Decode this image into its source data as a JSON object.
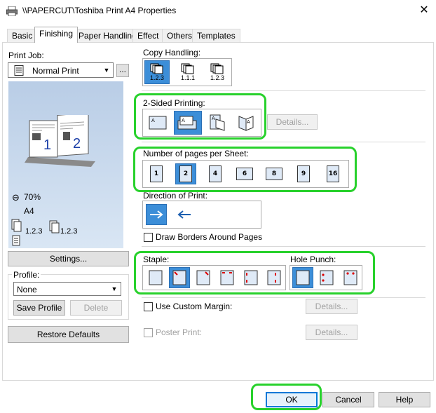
{
  "window": {
    "title": "\\\\PAPERCUT\\Toshiba Print A4 Properties",
    "close_glyph": "✕"
  },
  "tabs": [
    {
      "label": "Basic"
    },
    {
      "label": "Finishing"
    },
    {
      "label": "Paper Handling"
    },
    {
      "label": "Effect"
    },
    {
      "label": "Others"
    },
    {
      "label": "Templates"
    }
  ],
  "left": {
    "print_job_label": "Print Job:",
    "print_job_value": "Normal Print",
    "more_button": "...",
    "preview": {
      "zoom": "70%",
      "paper": "A4",
      "collate_a": "1.2.3",
      "collate_b": "1.2.3",
      "page_a": "1",
      "page_b": "2"
    },
    "settings_button": "Settings...",
    "profile_label": "Profile:",
    "profile_value": "None",
    "save_profile_button": "Save Profile",
    "delete_button": "Delete",
    "restore_defaults_button": "Restore Defaults"
  },
  "right": {
    "copy_handling_label": "Copy Handling:",
    "copy_handling_options": [
      "1.2.3",
      "1.1.1",
      "1.2.3"
    ],
    "two_sided_label": "2-Sided Printing:",
    "details_button": "Details...",
    "nup_label": "Number of pages per Sheet:",
    "nup_options": [
      "1",
      "2",
      "4",
      "6",
      "8",
      "9",
      "16"
    ],
    "direction_label": "Direction of Print:",
    "draw_borders_label": "Draw Borders Around Pages",
    "staple_label": "Staple:",
    "hole_punch_label": "Hole Punch:",
    "custom_margin_label": "Use Custom Margin:",
    "custom_margin_details": "Details...",
    "poster_print_label": "Poster Print:",
    "poster_print_details": "Details..."
  },
  "footer": {
    "ok": "OK",
    "cancel": "Cancel",
    "help": "Help"
  },
  "colors": {
    "selected": "#3c8ed8",
    "highlight": "#28d12c"
  }
}
